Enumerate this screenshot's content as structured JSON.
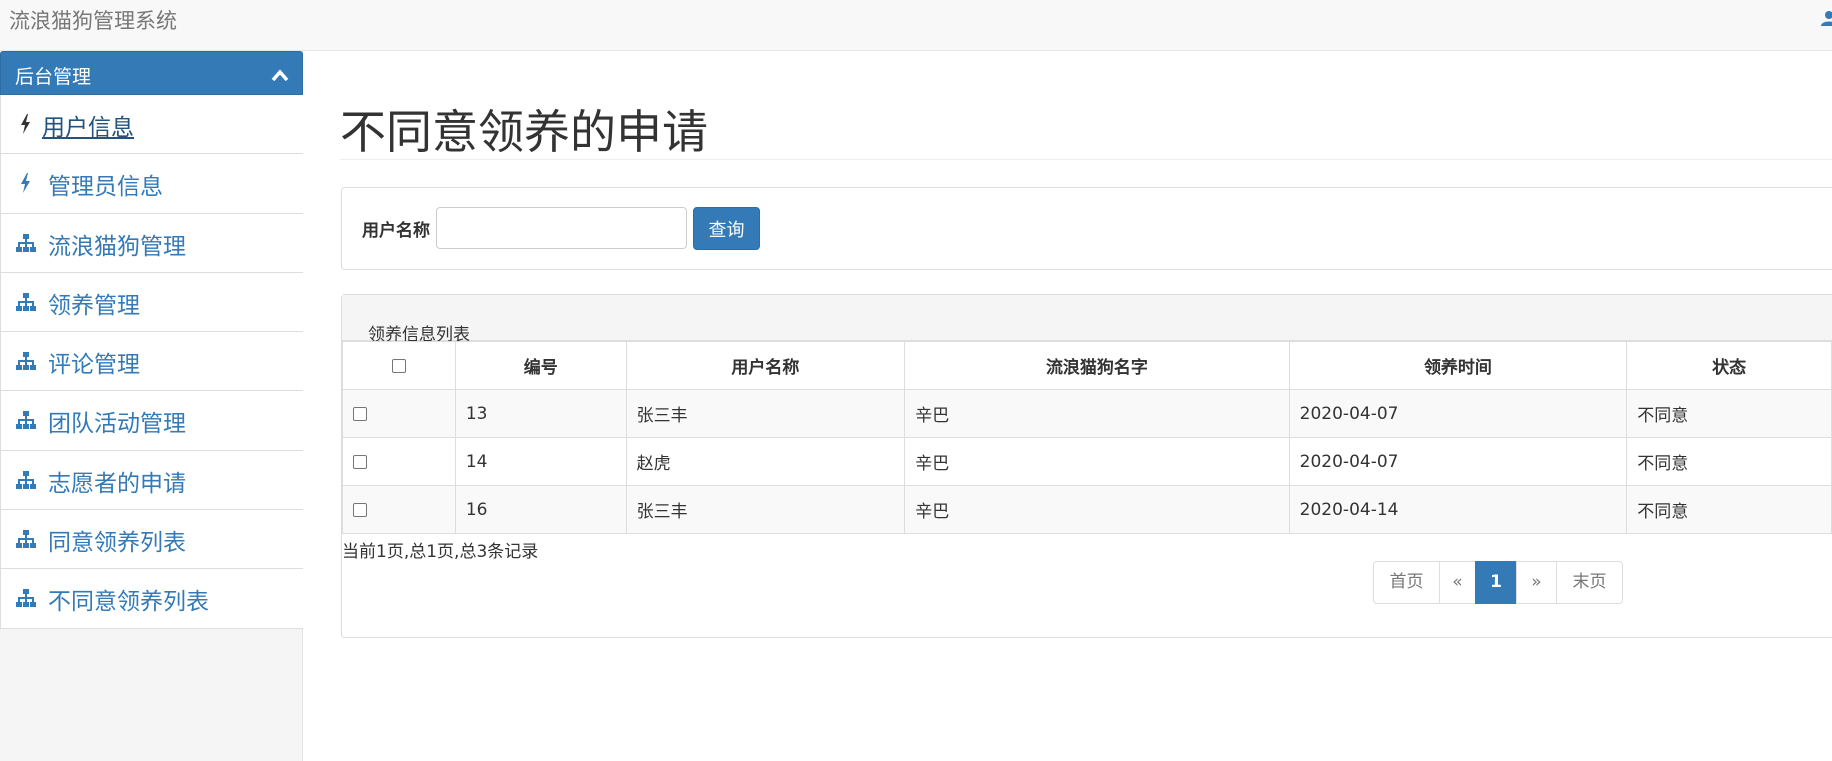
{
  "header": {
    "brand": "流浪猫狗管理系统"
  },
  "sidebar": {
    "panel_title": "后台管理",
    "items": [
      {
        "label": "用户信息",
        "icon": "bolt-icon"
      },
      {
        "label": "管理员信息",
        "icon": "bolt-icon"
      },
      {
        "label": "流浪猫狗管理",
        "icon": "sitemap-icon"
      },
      {
        "label": "领养管理",
        "icon": "sitemap-icon"
      },
      {
        "label": "评论管理",
        "icon": "sitemap-icon"
      },
      {
        "label": "团队活动管理",
        "icon": "sitemap-icon"
      },
      {
        "label": "志愿者的申请",
        "icon": "sitemap-icon"
      },
      {
        "label": "同意领养列表",
        "icon": "sitemap-icon"
      },
      {
        "label": "不同意领养列表",
        "icon": "sitemap-icon"
      }
    ]
  },
  "main": {
    "page_title": "不同意领养的申请",
    "search": {
      "label": "用户名称",
      "value": "",
      "button": "查询"
    },
    "list": {
      "title": "领养信息列表",
      "columns": [
        "编号",
        "用户名称",
        "流浪猫狗名字",
        "领养时间",
        "状态"
      ],
      "rows": [
        {
          "id": "13",
          "user": "张三丰",
          "pet": "辛巴",
          "date": "2020-04-07",
          "status": "不同意"
        },
        {
          "id": "14",
          "user": "赵虎",
          "pet": "辛巴",
          "date": "2020-04-07",
          "status": "不同意"
        },
        {
          "id": "16",
          "user": "张三丰",
          "pet": "辛巴",
          "date": "2020-04-14",
          "status": "不同意"
        }
      ],
      "page_info": "当前1页,总1页,总3条记录",
      "pager": {
        "first": "首页",
        "prev": "«",
        "current": "1",
        "next": "»",
        "last": "末页"
      }
    }
  },
  "colors": {
    "primary": "#337ab7",
    "link": "#337ab7",
    "navbar_bg": "#f8f8f8"
  }
}
